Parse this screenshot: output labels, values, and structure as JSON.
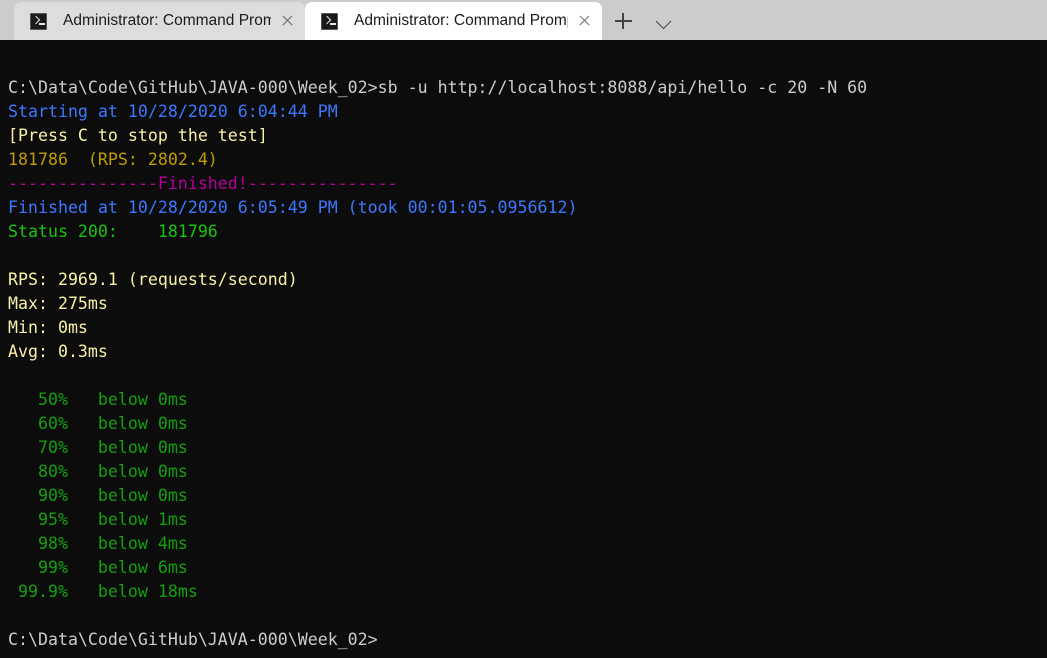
{
  "window": {
    "tabs": [
      {
        "title": "Administrator: Command Promp",
        "icon": "console-icon",
        "active": false
      },
      {
        "title": "Administrator: Command Promp",
        "icon": "console-icon",
        "active": true
      }
    ],
    "new_tab_icon": "plus-icon",
    "dropdown_icon": "chevron-down-icon"
  },
  "colors": {
    "background": "#0c0c0c",
    "default_text": "#cccccc",
    "blue": "#3b78ff",
    "pale_yellow": "#f9f1a5",
    "gold": "#c19c00",
    "magenta": "#b4009e",
    "bright_green": "#16c60c",
    "green": "#13a10e",
    "tabstrip_bg": "#cccccc",
    "active_tab_bg": "#ffffff",
    "inactive_tab_bg": "#dddddd"
  },
  "terminal": {
    "command_line": "C:\\Data\\Code\\GitHub\\JAVA-000\\Week_02>sb -u http://localhost:8088/api/hello -c 20 -N 60",
    "starting_at": "Starting at 10/28/2020 6:04:44 PM",
    "press_hint": "[Press C to stop the test]",
    "progress_counter": "181786  (RPS: 2802.4)",
    "finished_banner": "---------------Finished!---------------",
    "finished_at": "Finished at 10/28/2020 6:05:49 PM (took 00:01:05.0956612)",
    "status_line": "Status 200:    181796",
    "stats": [
      "RPS: 2969.1 (requests/second)",
      "Max: 275ms",
      "Min: 0ms",
      "Avg: 0.3ms"
    ],
    "percentiles": [
      "   50%   below 0ms",
      "   60%   below 0ms",
      "   70%   below 0ms",
      "   80%   below 0ms",
      "   90%   below 0ms",
      "   95%   below 1ms",
      "   98%   below 4ms",
      "   99%   below 6ms",
      " 99.9%   below 18ms"
    ],
    "final_prompt": "C:\\Data\\Code\\GitHub\\JAVA-000\\Week_02>"
  }
}
